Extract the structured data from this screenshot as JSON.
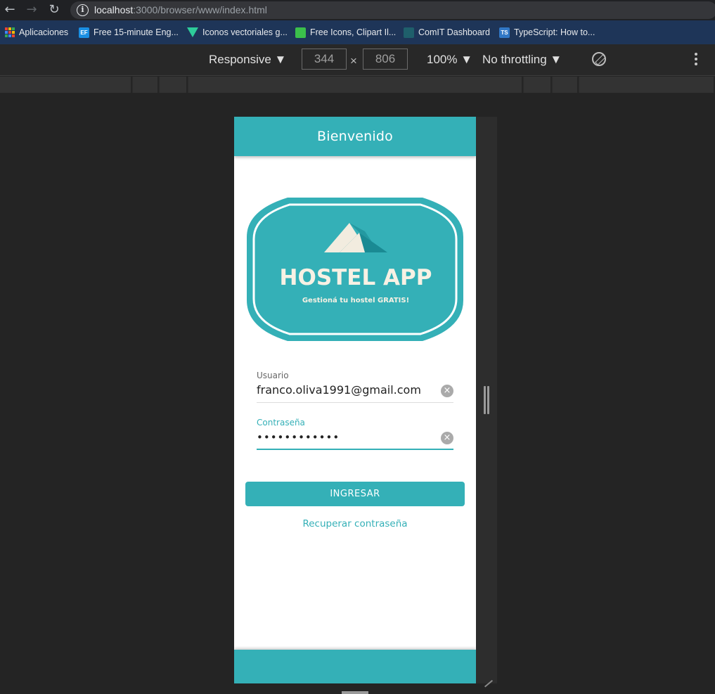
{
  "browser": {
    "url_host": "localhost",
    "url_path": ":3000/browser/www/index.html"
  },
  "bookmarks": [
    {
      "label": "Aplicaciones",
      "icon": "apps-grid-icon"
    },
    {
      "label": "Free 15-minute Eng...",
      "icon": "ef-icon"
    },
    {
      "label": "Iconos vectoriales g...",
      "icon": "vector-icon"
    },
    {
      "label": "Free Icons, Clipart Il...",
      "icon": "clipart-icon"
    },
    {
      "label": "ComIT Dashboard",
      "icon": "comit-icon"
    },
    {
      "label": "TypeScript: How to...",
      "icon": "ts-icon"
    }
  ],
  "devtools": {
    "device_mode": "Responsive",
    "width": "344",
    "height": "806",
    "zoom": "100%",
    "throttling": "No throttling"
  },
  "app": {
    "header_title": "Bienvenido",
    "logo": {
      "title": "HOSTEL APP",
      "tagline": "Gestioná tu hostel GRATIS!"
    },
    "username": {
      "label": "Usuario",
      "value": "franco.oliva1991@gmail.com"
    },
    "password": {
      "label": "Contraseña",
      "value": "••••••••••••"
    },
    "login_button": "INGRESAR",
    "recover_link": "Recuperar contraseña"
  },
  "colors": {
    "brand": "#34b0b7",
    "bookmark_bar": "#1e3558",
    "devtools_bg": "#242424"
  }
}
